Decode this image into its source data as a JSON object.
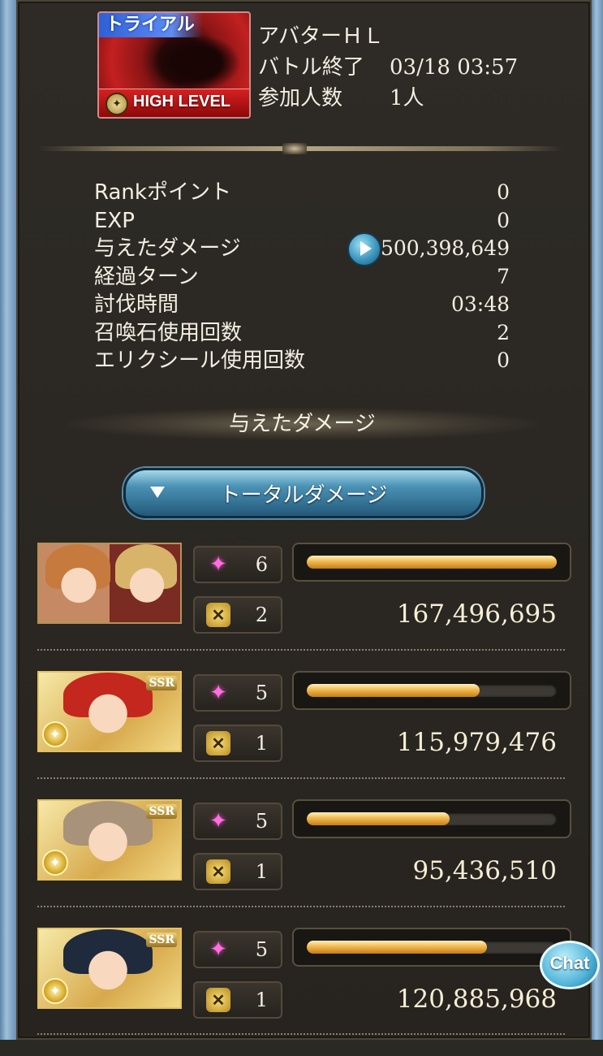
{
  "header": {
    "banner_tag": "トライアル",
    "banner_level": "HIGH LEVEL",
    "quest_name": "アバターＨＬ",
    "battle_end_label": "バトル終了",
    "battle_end_value": "03/18 03:57",
    "participants_label": "参加人数",
    "participants_value": "1人"
  },
  "stats": [
    {
      "label": "Rankポイント",
      "value": "0"
    },
    {
      "label": "EXP",
      "value": "0"
    },
    {
      "label": "与えたダメージ",
      "value": "500,398,649"
    },
    {
      "label": "経過ターン",
      "value": "7"
    },
    {
      "label": "討伐時間",
      "value": "03:48"
    },
    {
      "label": "召喚石使用回数",
      "value": "2"
    },
    {
      "label": "エリクシール使用回数",
      "value": "0"
    }
  ],
  "section_title": "与えたダメージ",
  "dropdown_label": "トータルダメージ",
  "party": [
    {
      "ougi": "6",
      "skills": "2",
      "damage": "167,496,695",
      "bar_fraction": 1.0,
      "ssr": ""
    },
    {
      "ougi": "5",
      "skills": "1",
      "damage": "115,979,476",
      "bar_fraction": 0.69,
      "ssr": "SSR"
    },
    {
      "ougi": "5",
      "skills": "1",
      "damage": "95,436,510",
      "bar_fraction": 0.57,
      "ssr": "SSR"
    },
    {
      "ougi": "5",
      "skills": "1",
      "damage": "120,885,968",
      "bar_fraction": 0.72,
      "ssr": "SSR"
    }
  ],
  "chat_label": "Chat",
  "colors": {
    "bar": "#f2b950",
    "accent_blue": "#4b92b5",
    "star": "#ff6fe1"
  }
}
